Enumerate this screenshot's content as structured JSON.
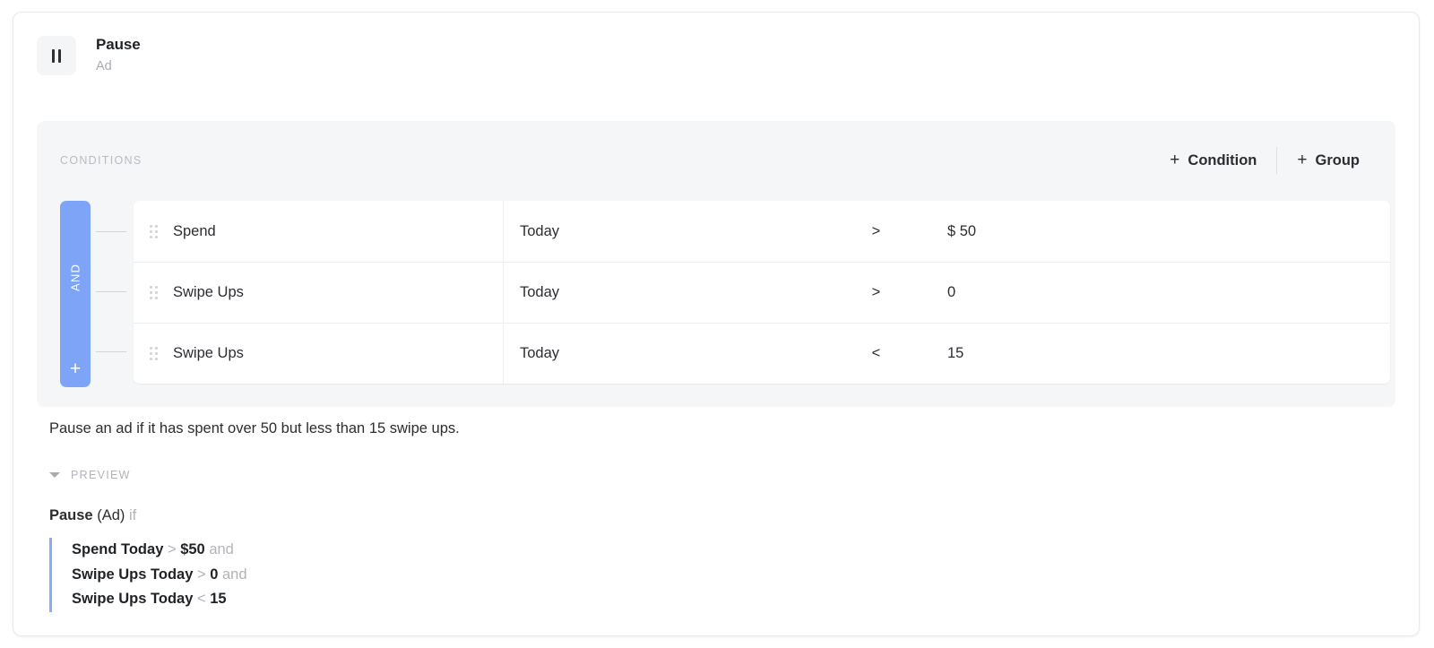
{
  "rule": {
    "action_icon": "pause-icon",
    "action_title": "Pause",
    "action_level": "Ad"
  },
  "conditions_panel": {
    "label": "CONDITIONS",
    "add_condition_label": "Condition",
    "add_group_label": "Group",
    "plus_glyph": "+",
    "group": {
      "logic_label": "AND",
      "add_glyph": "+",
      "accent_color": "#7ea4f7"
    },
    "rows": [
      {
        "drag": "drag-handle-icon",
        "metric": "Spend",
        "window": "Today",
        "operator": ">",
        "value": "$ 50"
      },
      {
        "drag": "drag-handle-icon",
        "metric": "Swipe Ups",
        "window": "Today",
        "operator": ">",
        "value": "0"
      },
      {
        "drag": "drag-handle-icon",
        "metric": "Swipe Ups",
        "window": "Today",
        "operator": "<",
        "value": "15"
      }
    ]
  },
  "description": "Pause an ad if it has spent over 50 but less than 15 swipe ups.",
  "preview": {
    "toggle_label": "PREVIEW",
    "caret_icon": "caret-down-icon",
    "expanded": true,
    "head_action": "Pause",
    "head_level": "(Ad)",
    "head_if": "if",
    "lines": [
      {
        "subject": "Spend Today",
        "operator": ">",
        "value": "$50",
        "conjunction": "and"
      },
      {
        "subject": "Swipe Ups Today",
        "operator": ">",
        "value": "0",
        "conjunction": "and"
      },
      {
        "subject": "Swipe Ups Today",
        "operator": "<",
        "value": "15",
        "conjunction": ""
      }
    ]
  }
}
